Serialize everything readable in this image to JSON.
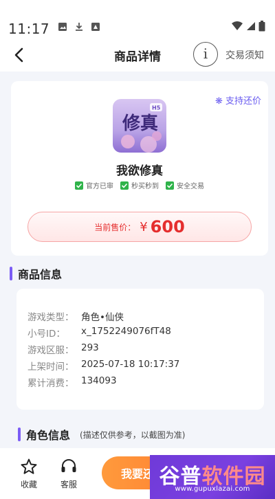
{
  "status_bar": {
    "time": "11:17"
  },
  "nav": {
    "title": "商品详情",
    "info_icon": "i",
    "notice": "交易须知"
  },
  "product": {
    "bargain": "❋ 支持还价",
    "icon_text": "修真",
    "icon_badge": "H5",
    "name": "我欲修真",
    "features": [
      "官方已审",
      "秒买秒到",
      "安全交易"
    ],
    "price_label": "当前售价：",
    "currency": "¥",
    "price": "600"
  },
  "section_product_info": {
    "title": "商品信息"
  },
  "info_rows": [
    {
      "label": "游戏类型：",
      "value": "角色•仙侠"
    },
    {
      "label": "小号ID：",
      "value": "x_1752249076fT48"
    },
    {
      "label": "游戏区服：",
      "value": "293"
    },
    {
      "label": "上架时间：",
      "value": "2025-07-18 10:17:37"
    },
    {
      "label": "累计消费：",
      "value": "134093"
    }
  ],
  "section_role_info": {
    "title": "角色信息",
    "subtitle": "(描述仅供参考，以截图为准)"
  },
  "bottom": {
    "favorite_label": "收藏",
    "service_label": "客服",
    "primary_label": "我要还"
  },
  "watermark": {
    "title_part1": "谷普",
    "title_part2": "软件园",
    "url": "www.gupuxlazai.com"
  },
  "colors": {
    "accent": "#7b5cf5",
    "price": "#e52e2e",
    "primary_button": "#ff7a2f"
  }
}
